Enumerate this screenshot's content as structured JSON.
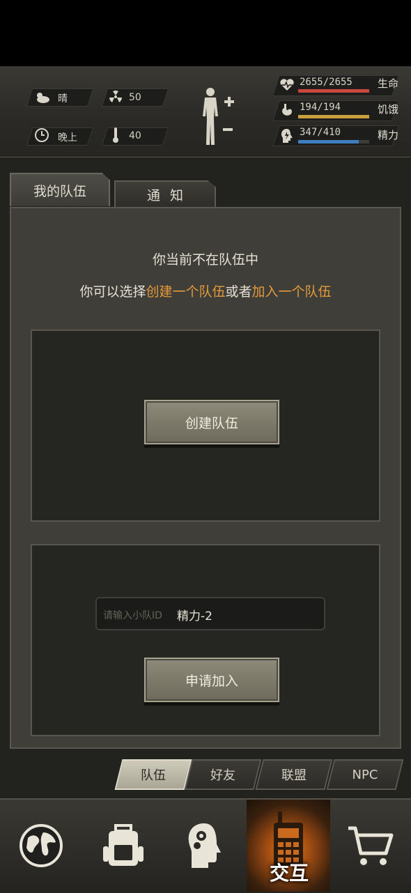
{
  "status": {
    "weather_label": "晴",
    "radiation_value": "50",
    "time_label": "晚上",
    "temperature_value": "40"
  },
  "bars": {
    "life": {
      "text": "2655/2655",
      "name": "生命",
      "percent": 100,
      "color": "#c9473d"
    },
    "hunger": {
      "text": "194/194",
      "name": "饥饿",
      "percent": 100,
      "color": "#c9a03d"
    },
    "energy": {
      "text": "347/410",
      "name": "精力",
      "percent": 85,
      "color": "#3f7fc0"
    }
  },
  "tabs": {
    "my_team": "我的队伍",
    "notice": "通知"
  },
  "message": {
    "line1": "你当前不在队伍中",
    "line2_prefix": "你可以选择",
    "line2_create": "创建一个队伍",
    "line2_or": "或者",
    "line2_join": "加入一个队伍"
  },
  "create_button": "创建队伍",
  "join": {
    "placeholder": "请输入小队ID",
    "value": "精力-2",
    "button": "申请加入"
  },
  "subtabs": [
    "队伍",
    "好友",
    "联盟",
    "NPC"
  ],
  "nav": {
    "active_label": "交互"
  }
}
